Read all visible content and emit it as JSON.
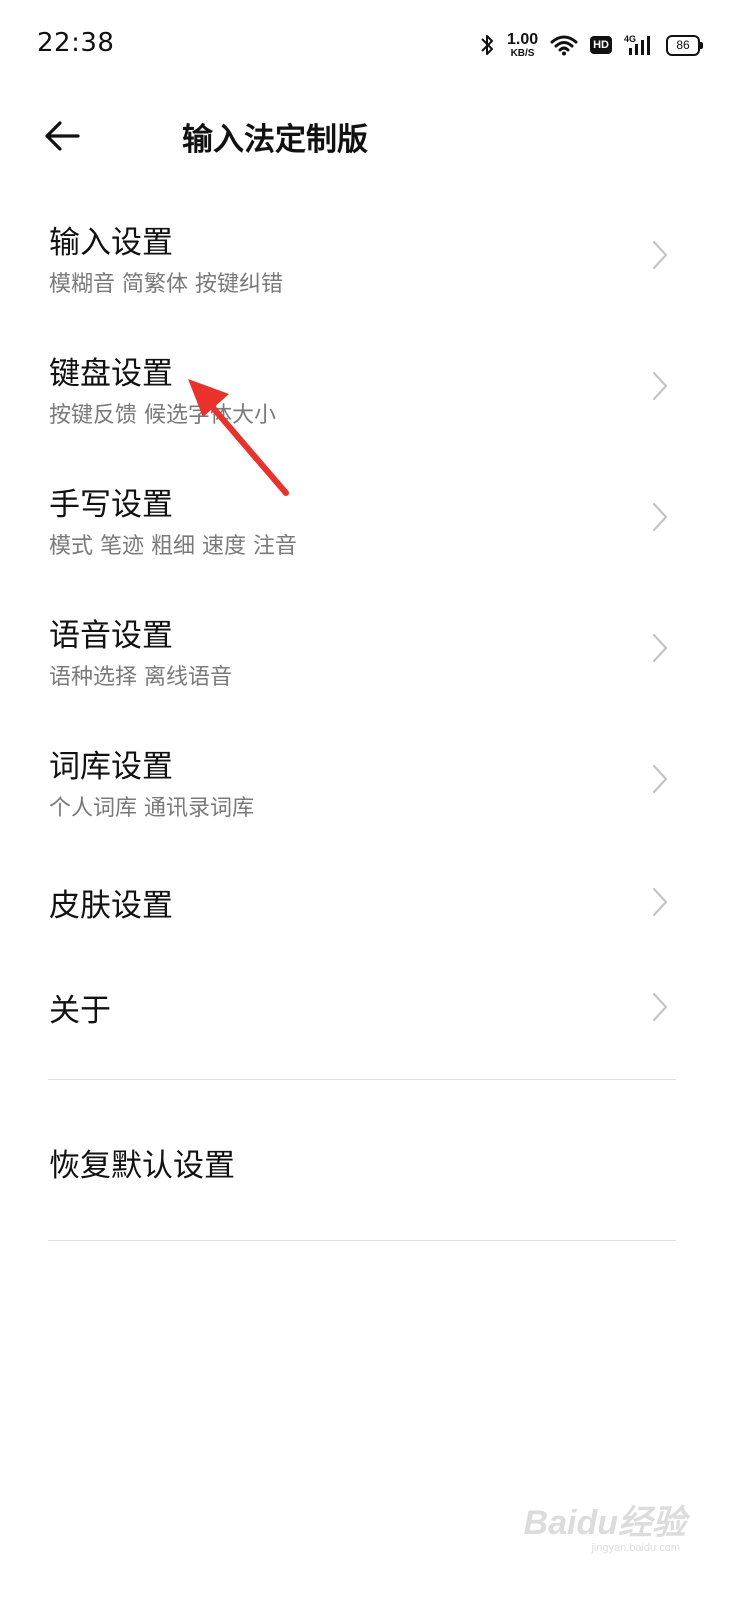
{
  "status_bar": {
    "time": "22:38",
    "net_speed": "1.00",
    "net_unit": "KB/S",
    "hd": "HD",
    "network": "4G",
    "battery": "86"
  },
  "header": {
    "title": "输入法定制版",
    "back_icon": "arrow-left-icon"
  },
  "settings": [
    {
      "title": "输入设置",
      "subtitle": "模糊音 简繁体 按键纠错"
    },
    {
      "title": "键盘设置",
      "subtitle": "按键反馈 候选字体大小"
    },
    {
      "title": "手写设置",
      "subtitle": "模式 笔迹 粗细 速度 注音"
    },
    {
      "title": "语音设置",
      "subtitle": "语种选择 离线语音"
    },
    {
      "title": "词库设置",
      "subtitle": "个人词库 通讯录词库"
    },
    {
      "title": "皮肤设置"
    },
    {
      "title": "关于"
    }
  ],
  "reset": {
    "title": "恢复默认设置"
  },
  "watermark": {
    "brand": "Baidu经验",
    "url": "jingyan.baidu.com"
  },
  "colors": {
    "annotation": "#e8322b",
    "subtitle": "#7a7a7a",
    "chevron": "#c4c4c4"
  }
}
